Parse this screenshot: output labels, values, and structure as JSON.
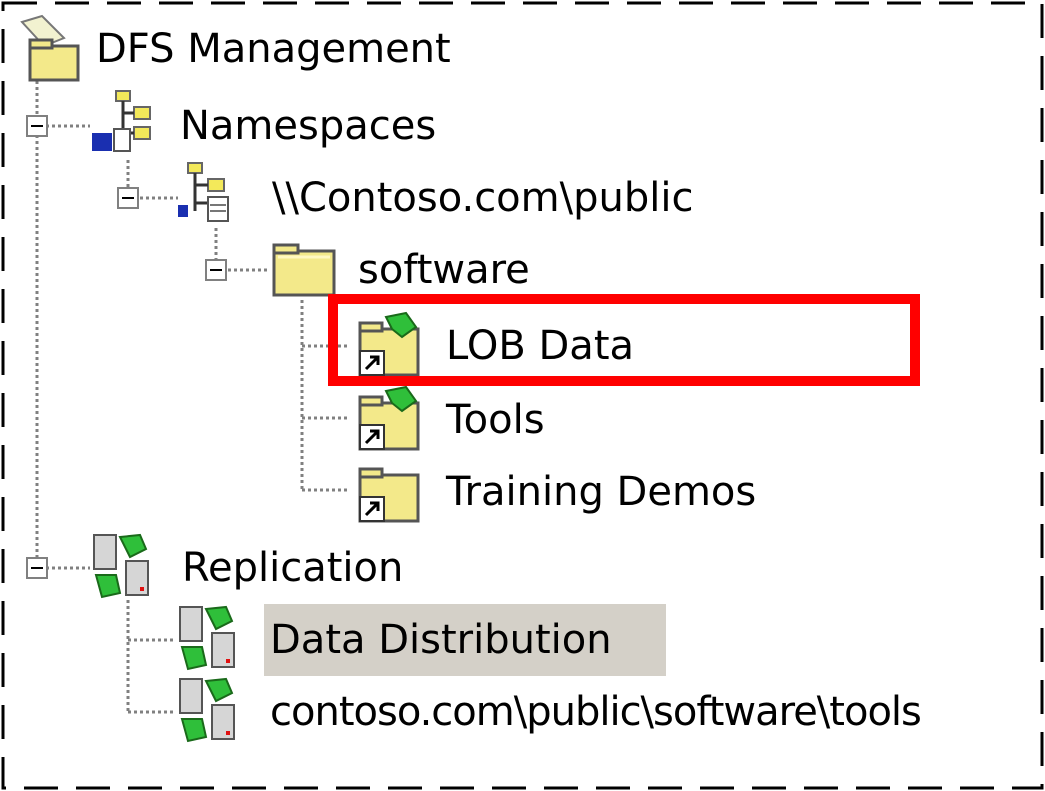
{
  "tree": {
    "root": {
      "label": "DFS Management",
      "icon": "dfs-management-icon"
    },
    "namespaces": {
      "label": "Namespaces",
      "icon": "namespaces-icon",
      "expanded": true,
      "namespace": {
        "label": "\\\\Contoso.com\\public",
        "icon": "namespace-server-icon",
        "expanded": true,
        "folder": {
          "label": "software",
          "icon": "folder-icon",
          "expanded": true,
          "children": [
            {
              "label": "LOB Data",
              "icon": "replicated-folder-target-icon",
              "highlighted": true
            },
            {
              "label": "Tools",
              "icon": "replicated-folder-target-icon"
            },
            {
              "label": "Training Demos",
              "icon": "folder-target-icon"
            }
          ]
        }
      }
    },
    "replication": {
      "label": "Replication",
      "icon": "replication-icon",
      "expanded": true,
      "groups": [
        {
          "label": "Data Distribution",
          "icon": "replication-group-icon",
          "selected": true
        },
        {
          "label": "contoso.com\\public\\software\\tools",
          "icon": "replication-group-icon"
        }
      ]
    }
  },
  "colors": {
    "highlight_border": "#ff0000",
    "selection_background": "#d4d0c8",
    "connector_line": "#808080"
  }
}
